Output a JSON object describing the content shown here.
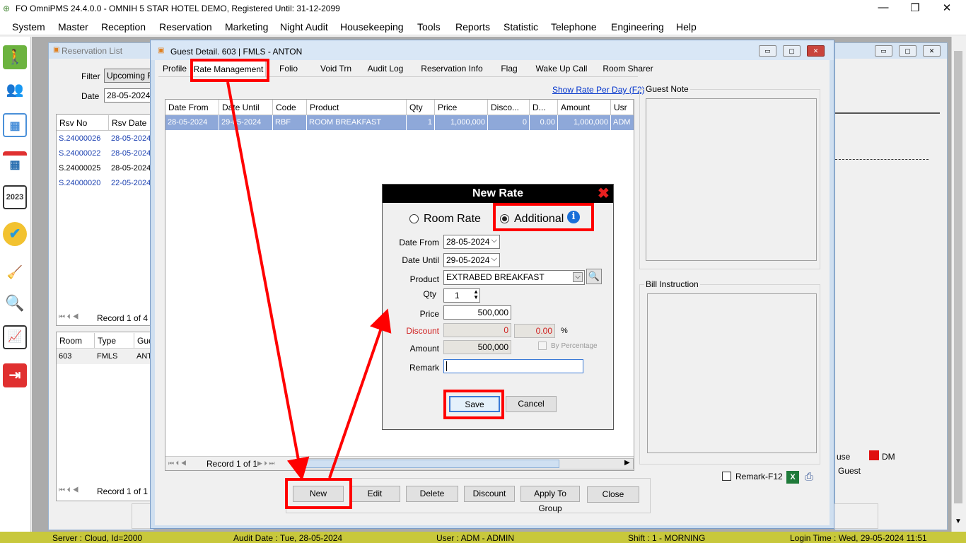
{
  "app_title": "FO OmniPMS 24.4.0.0 - OMNIH 5 STAR HOTEL DEMO, Registered Until: 31-12-2099",
  "window_controls": {
    "minimize": "—",
    "restore": "❐",
    "close": "✕"
  },
  "menu": [
    "System",
    "Master",
    "Reception",
    "Reservation",
    "Marketing",
    "Night Audit",
    "Housekeeping",
    "Tools",
    "Reports",
    "Statistic",
    "Telephone",
    "Engineering",
    "Help"
  ],
  "reservation_list": {
    "title": "Reservation List",
    "filter_label": "Filter",
    "filter_value": "Upcoming Re",
    "date_label": "Date",
    "date_value": "28-05-2024",
    "columns": [
      "Rsv No",
      "Rsv Date"
    ],
    "rows": [
      {
        "rsv_no": "S.24000026",
        "rsv_date": "28-05-2024"
      },
      {
        "rsv_no": "S.24000022",
        "rsv_date": "28-05-2024"
      },
      {
        "rsv_no": "S.24000025",
        "rsv_date": "28-05-2024"
      },
      {
        "rsv_no": "S.24000020",
        "rsv_date": "22-05-2024"
      }
    ],
    "record_text": "Record 1 of 4",
    "room_columns": [
      "Room",
      "Type",
      "Gue"
    ],
    "room_rows": [
      {
        "room": "603",
        "type": "FMLS",
        "guest": "ANT"
      }
    ],
    "room_record_text": "Record 1 of 1"
  },
  "guest_detail": {
    "title": "Guest Detail. 603 | FMLS - ANTON",
    "tabs": [
      "Profile",
      "Rate Management",
      "Folio",
      "Void Trn",
      "Audit Log",
      "Reservation Info",
      "Flag",
      "Wake Up Call",
      "Room Sharer"
    ],
    "show_rate_link": "Show Rate Per Day (F2)",
    "columns": [
      "Date From",
      "Date Until",
      "Code",
      "Product",
      "Qty",
      "Price",
      "Disco...",
      "D...",
      "Amount",
      "Usr"
    ],
    "rows": [
      {
        "date_from": "28-05-2024",
        "date_until": "29-05-2024",
        "code": "RBF",
        "product": "ROOM BREAKFAST",
        "qty": "1",
        "price": "1,000,000",
        "discount": "0",
        "disc_pct": "0.00",
        "amount": "1,000,000",
        "usr": "ADM"
      }
    ],
    "record_text": "Record 1 of 1",
    "guest_note_label": "Guest Note",
    "bill_instruction_label": "Bill Instruction",
    "remark_label": "Remark-F12",
    "buttons": {
      "new": "New",
      "edit": "Edit",
      "delete": "Delete",
      "discount": "Discount",
      "apply_group": "Apply To Group",
      "close": "Close"
    }
  },
  "new_rate": {
    "title": "New Rate",
    "radio_room_rate": "Room Rate",
    "radio_additional": "Additional",
    "selected": "Additional",
    "date_from_label": "Date From",
    "date_from": "28-05-2024",
    "date_until_label": "Date Until",
    "date_until": "29-05-2024",
    "product_label": "Product",
    "product": "EXTRABED BREAKFAST",
    "qty_label": "Qty",
    "qty": "1",
    "price_label": "Price",
    "price": "500,000",
    "discount_label": "Discount",
    "discount": "0",
    "discount_pct": "0.00",
    "pct_sign": "%",
    "amount_label": "Amount",
    "amount": "500,000",
    "by_percentage": "By Percentage",
    "remark_label": "Remark",
    "remark": "",
    "save": "Save",
    "cancel": "Cancel"
  },
  "bg_window": {
    "legend_use": "use",
    "legend_dm": "DM",
    "legend_guest": "Guest"
  },
  "status": {
    "server": "Server : Cloud, Id=2000",
    "audit_date": "Audit Date : Tue, 28-05-2024",
    "user": "User : ADM - ADMIN",
    "shift": "Shift : 1 - MORNING",
    "login_time": "Login Time : Wed, 29-05-2024 11:51"
  },
  "colors": {
    "status_bar": "#c8c83c",
    "selected_row": "#8ea8d9",
    "annotation": "#ff0000",
    "dialog_title": "#000000"
  }
}
